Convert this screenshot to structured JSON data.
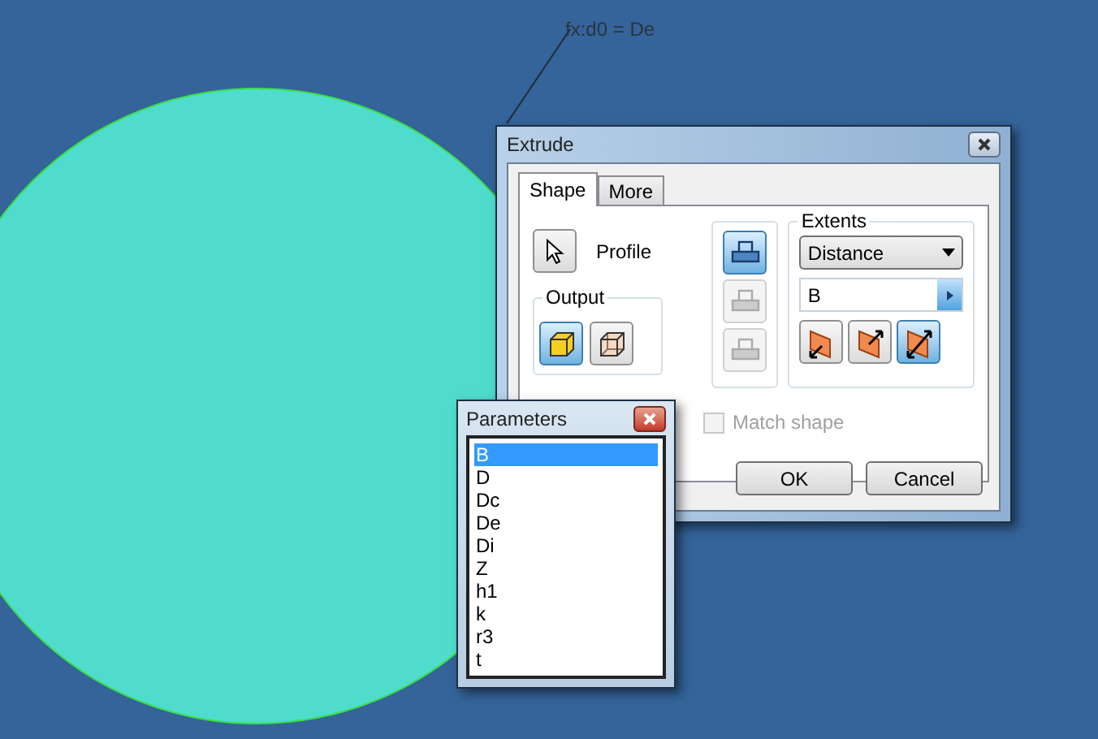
{
  "annotation": {
    "text": "fx:d0 = De"
  },
  "extrude": {
    "title": "Extrude",
    "tabs": [
      {
        "label": "Shape",
        "selected": true
      },
      {
        "label": "More",
        "selected": false
      }
    ],
    "profile_label": "Profile",
    "output": {
      "label": "Output",
      "buttons": [
        {
          "kind": "solid",
          "selected": true
        },
        {
          "kind": "surface",
          "selected": false
        }
      ]
    },
    "mode_buttons": [
      {
        "selected": true,
        "disabled": false
      },
      {
        "selected": false,
        "disabled": true
      },
      {
        "selected": false,
        "disabled": true
      }
    ],
    "extents": {
      "label": "Extents",
      "type": "Distance",
      "value": "B",
      "direction_buttons": [
        {
          "kind": "direction1",
          "selected": false
        },
        {
          "kind": "direction2",
          "selected": false
        },
        {
          "kind": "symmetric",
          "selected": true
        }
      ]
    },
    "match_shape": {
      "label": "Match shape",
      "checked": false,
      "disabled": true
    },
    "buttons": [
      "OK",
      "Cancel"
    ]
  },
  "parameters": {
    "title": "Parameters",
    "items": [
      {
        "label": "B",
        "selected": true
      },
      {
        "label": "D",
        "selected": false
      },
      {
        "label": "Dc",
        "selected": false
      },
      {
        "label": "De",
        "selected": false
      },
      {
        "label": "Di",
        "selected": false
      },
      {
        "label": "Z",
        "selected": false
      },
      {
        "label": "h1",
        "selected": false
      },
      {
        "label": "k",
        "selected": false
      },
      {
        "label": "r3",
        "selected": false
      },
      {
        "label": "t",
        "selected": false
      }
    ]
  }
}
